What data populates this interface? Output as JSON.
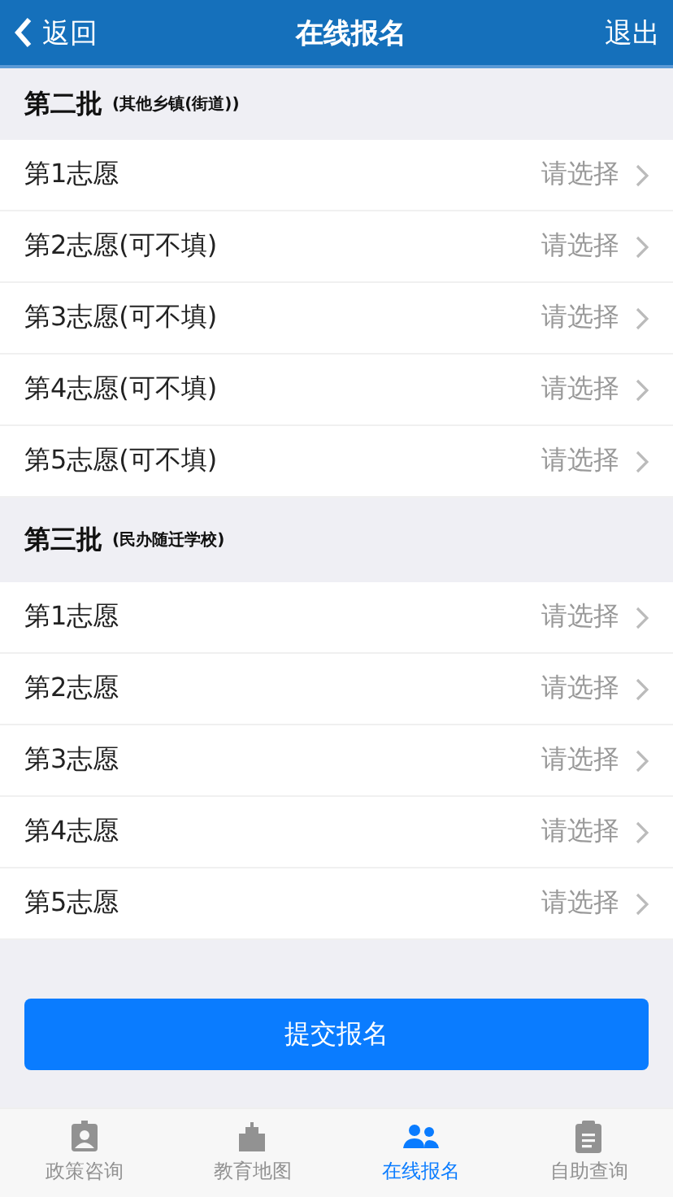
{
  "header": {
    "back": "返回",
    "title": "在线报名",
    "logout": "退出"
  },
  "sections": [
    {
      "title": "第二批",
      "subtitle": "(其他乡镇(街道))",
      "rows": [
        {
          "label": "第1志愿",
          "value": "请选择"
        },
        {
          "label": "第2志愿(可不填)",
          "value": "请选择"
        },
        {
          "label": "第3志愿(可不填)",
          "value": "请选择"
        },
        {
          "label": "第4志愿(可不填)",
          "value": "请选择"
        },
        {
          "label": "第5志愿(可不填)",
          "value": "请选择"
        }
      ]
    },
    {
      "title": "第三批",
      "subtitle": "(民办随迁学校)",
      "rows": [
        {
          "label": "第1志愿",
          "value": "请选择"
        },
        {
          "label": "第2志愿",
          "value": "请选择"
        },
        {
          "label": "第3志愿",
          "value": "请选择"
        },
        {
          "label": "第4志愿",
          "value": "请选择"
        },
        {
          "label": "第5志愿",
          "value": "请选择"
        }
      ]
    }
  ],
  "submit": "提交报名",
  "tabs": [
    {
      "label": "政策咨询",
      "kind": "badge",
      "selected": false
    },
    {
      "label": "教育地图",
      "kind": "building",
      "selected": false
    },
    {
      "label": "在线报名",
      "kind": "people",
      "selected": true
    },
    {
      "label": "自助查询",
      "kind": "clipboard",
      "selected": false
    }
  ]
}
